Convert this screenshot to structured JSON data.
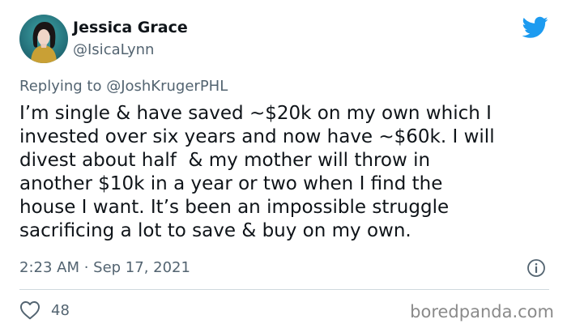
{
  "author": {
    "display_name": "Jessica Grace",
    "handle": "@IsicaLynn",
    "avatar_icon": "profile-photo"
  },
  "reply": {
    "prefix": "Replying to ",
    "mention": "@JoshKrugerPHL"
  },
  "tweet": {
    "lines": [
      "I’m single & have saved ~$20k on my own which I",
      "invested over six years and now have ~$60k. I will",
      "divest about half  & my mother will throw in",
      "another $10k in a year or two when I find the",
      "house I want. It’s been an impossible struggle",
      "sacrificing a lot to save & buy on my own."
    ]
  },
  "meta": {
    "timestamp": "2:23 AM · Sep 17, 2021"
  },
  "actions": {
    "likes": "48",
    "like_icon": "heart-icon",
    "info_icon": "info-icon"
  },
  "watermark": "boredpanda.com",
  "colors": {
    "twitter_blue": "#1d9bf0",
    "secondary_text": "#536471",
    "primary_text": "#0f1419"
  }
}
